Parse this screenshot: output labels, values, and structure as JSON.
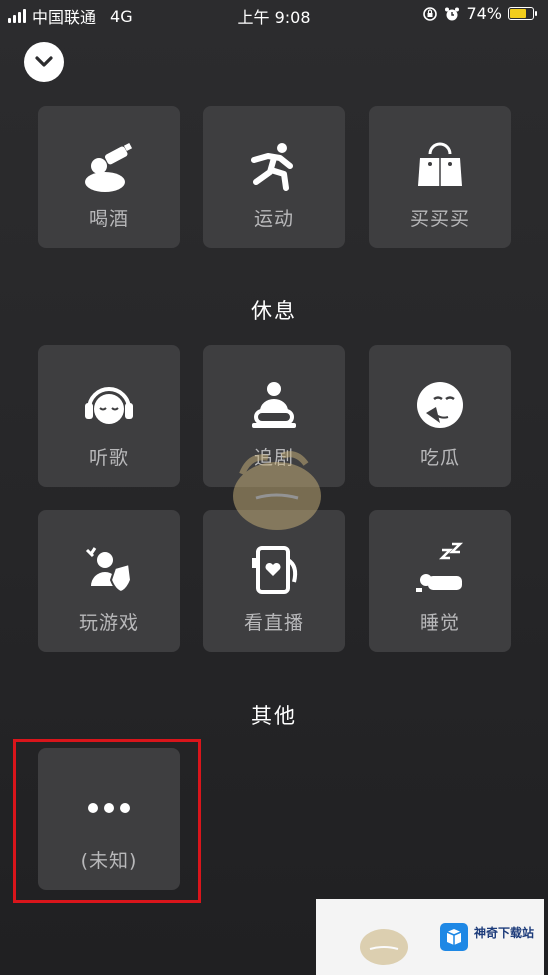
{
  "status_bar": {
    "carrier": "中国联通",
    "network": "4G",
    "time": "上午 9:08",
    "battery": "74%",
    "battery_level": 0.74
  },
  "sections": [
    {
      "title": "",
      "tiles": [
        {
          "label": "喝酒",
          "icon": "drinking-icon"
        },
        {
          "label": "运动",
          "icon": "running-icon"
        },
        {
          "label": "买买买",
          "icon": "shopping-bag-icon"
        }
      ]
    },
    {
      "title": "休息",
      "tiles": [
        {
          "label": "听歌",
          "icon": "headphones-icon"
        },
        {
          "label": "追剧",
          "icon": "tv-watching-icon"
        },
        {
          "label": "吃瓜",
          "icon": "eating-melon-icon"
        },
        {
          "label": "玩游戏",
          "icon": "gaming-icon"
        },
        {
          "label": "看直播",
          "icon": "live-stream-icon"
        },
        {
          "label": "睡觉",
          "icon": "sleeping-icon"
        }
      ]
    },
    {
      "title": "其他",
      "tiles": [
        {
          "label": "(未知)",
          "icon": "more-dots-icon"
        }
      ]
    }
  ],
  "badge": {
    "text": "神奇下载站"
  },
  "colors": {
    "highlight": "#d9151b",
    "tile_bg": "#3e3e40",
    "battery_fill": "#f2cd1c"
  }
}
